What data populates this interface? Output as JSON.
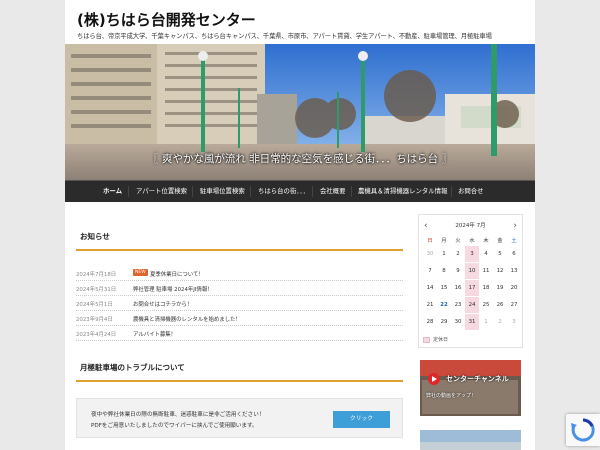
{
  "site": {
    "title": "(株)ちはら台開発センター",
    "tagline": "ちはら台、帝京平成大学、千葉キャンパス、ちはら台キャンパス、千葉県、市原市、アパート賃貸、学生アパート、不動産、駐車場管理、月極駐車場"
  },
  "hero": {
    "caption": "〖 爽やかな風が流れ 非日常的な空気を感じる街．．．ちはら台 〗"
  },
  "nav": {
    "items": [
      "ホーム",
      "アパート位置検索",
      "駐車場位置検索",
      "ちはら台の街．．．",
      "会社概要",
      "農機具＆清掃機器レンタル情報",
      "お問合せ"
    ]
  },
  "news": {
    "heading": "お知らせ",
    "new_badge": "NEW",
    "items": [
      {
        "date": "2024年7月18日",
        "title": "夏季休業日について！"
      },
      {
        "date": "2024年5月31日",
        "title": "弊社管理 駐車場 2024年JI情報！"
      },
      {
        "date": "2024年5月1日",
        "title": "お問合せはコチラから！"
      },
      {
        "date": "2023年9月4日",
        "title": "農機具と清掃機器のレンタルを始めました！"
      },
      {
        "date": "2023年4月24日",
        "title": "アルバイト募集！"
      }
    ]
  },
  "trouble": {
    "heading": "月極駐車場のトラブルについて",
    "line1": "夜中や弊社休業日の際の無断駐車、迷惑駐車に是非ご活用ください！",
    "line2": "PDFをご用意いたしましたのでワイパーに挟んでご使用願います。",
    "button": "クリック"
  },
  "calendar": {
    "title": "2024年 7月",
    "prev": "‹",
    "next": "›",
    "weekdays": [
      "日",
      "月",
      "火",
      "水",
      "木",
      "金",
      "土"
    ],
    "weeks": [
      [
        "30",
        "1",
        "2",
        "3",
        "4",
        "5",
        "6"
      ],
      [
        "7",
        "8",
        "9",
        "10",
        "11",
        "12",
        "13"
      ],
      [
        "14",
        "15",
        "16",
        "17",
        "18",
        "19",
        "20"
      ],
      [
        "21",
        "22",
        "23",
        "24",
        "25",
        "26",
        "27"
      ],
      [
        "28",
        "29",
        "30",
        "31",
        "1",
        "2",
        "3"
      ]
    ],
    "closed": [
      "3",
      "10",
      "17",
      "24",
      "31"
    ],
    "today": "22",
    "legend": "定休日"
  },
  "banner": {
    "title": "センターチャンネル",
    "sub": "弊社の動画をアップ！"
  },
  "colors": {
    "accent_orange": "#e0a030",
    "nav_bg": "#2b2b2b",
    "button_blue": "#3d9ed8",
    "closed_pink": "#f7d9e1"
  }
}
